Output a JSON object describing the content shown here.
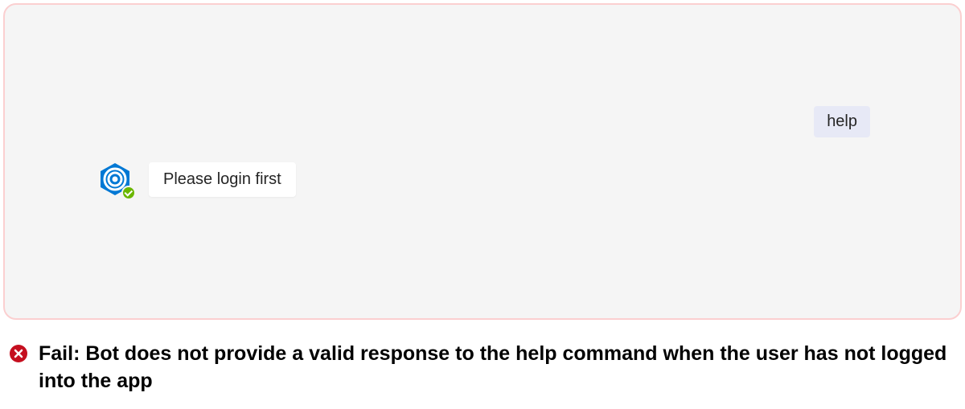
{
  "chat": {
    "user_message": "help",
    "bot_message": "Please login first"
  },
  "result": {
    "status_label": "Fail",
    "message": "Fail: Bot does not provide a valid response to the help command when the user has not logged into the app"
  },
  "icons": {
    "bot_avatar": "bot-hexagon-swirl-icon",
    "status": "available-check-icon",
    "fail": "error-circle-icon"
  },
  "colors": {
    "panel_border": "#fbcfd0",
    "panel_bg": "#f5f5f5",
    "user_bubble": "#e7e9f6",
    "bot_bubble": "#ffffff",
    "status_green": "#6bb700",
    "fail_red": "#c50f1f",
    "avatar_blue": "#0078d4"
  }
}
